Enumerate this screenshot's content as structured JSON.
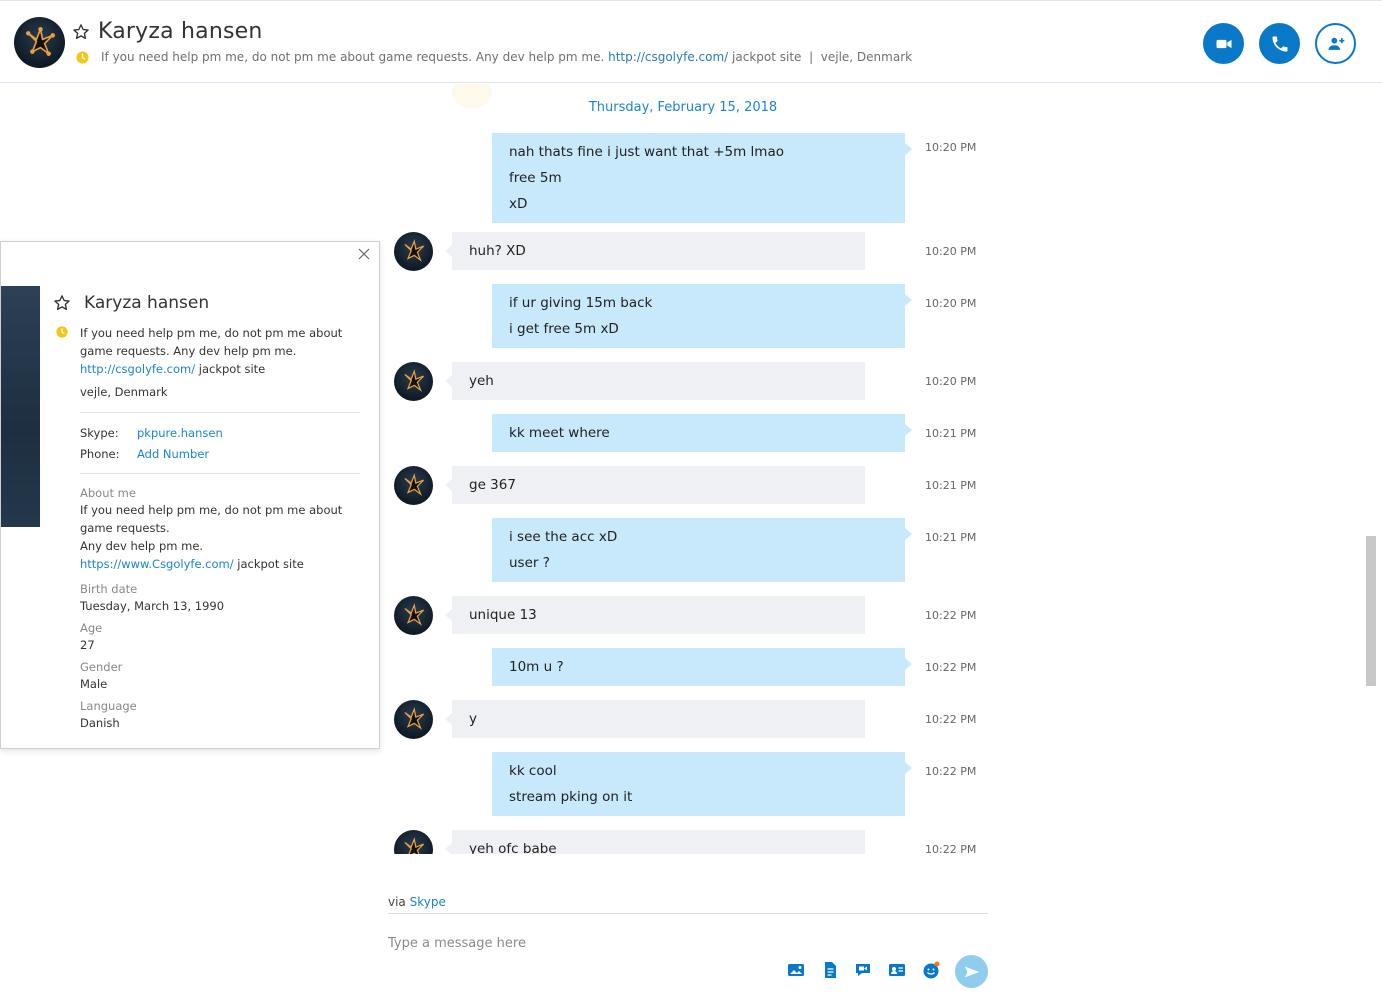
{
  "header": {
    "name": "Karyza hansen",
    "mood_text": "If you need help pm me, do not pm me about game requests. Any dev help pm me.",
    "mood_link": "http://csgolyfe.com/",
    "mood_after": "jackpot site",
    "separator": "|",
    "location": "vejle, Denmark"
  },
  "chat": {
    "date": "Thursday, February 15, 2018",
    "messages": [
      {
        "dir": "out",
        "lines": [
          "nah thats fine i just want that +5m lmao",
          "free 5m",
          "xD"
        ],
        "time": "10:20 PM"
      },
      {
        "dir": "in",
        "lines": [
          "huh? XD"
        ],
        "time": "10:20 PM"
      },
      {
        "dir": "out",
        "lines": [
          "if ur giving 15m back",
          "i get free 5m xD"
        ],
        "time": "10:20 PM"
      },
      {
        "dir": "in",
        "lines": [
          "yeh"
        ],
        "time": "10:20 PM"
      },
      {
        "dir": "out",
        "lines": [
          "kk meet where"
        ],
        "time": "10:21 PM"
      },
      {
        "dir": "in",
        "lines": [
          "ge 367"
        ],
        "time": "10:21 PM"
      },
      {
        "dir": "out",
        "lines": [
          "i see the acc xD",
          "user ?"
        ],
        "time": "10:21 PM"
      },
      {
        "dir": "in",
        "lines": [
          "unique 13"
        ],
        "time": "10:22 PM"
      },
      {
        "dir": "out",
        "lines": [
          "10m u ?"
        ],
        "time": "10:22 PM"
      },
      {
        "dir": "in",
        "lines": [
          "y"
        ],
        "time": "10:22 PM"
      },
      {
        "dir": "out",
        "lines": [
          "kk cool",
          "stream pking on it"
        ],
        "time": "10:22 PM"
      },
      {
        "dir": "in",
        "lines": [
          "yeh ofc babe"
        ],
        "time": "10:22 PM"
      }
    ]
  },
  "composer": {
    "via_prefix": "via",
    "via_link": "Skype",
    "placeholder": "Type a message here"
  },
  "profile": {
    "name": "Karyza hansen",
    "mood_text": "If you need help pm me, do not pm me about game requests. Any dev help pm me.",
    "mood_link": "http://csgolyfe.com/",
    "mood_after": "jackpot site",
    "location": "vejle, Denmark",
    "skype_label": "Skype:",
    "skype_value": "pkpure.hansen",
    "phone_label": "Phone:",
    "phone_value": "Add Number",
    "about_label": "About me",
    "about_line1": "If you need help pm me, do not pm me about game requests.",
    "about_line2": "Any dev help pm me.",
    "about_link": "https://www.Csgolyfe.com/",
    "about_after": "jackpot site",
    "birth_label": "Birth date",
    "birth_value": "Tuesday, March 13, 1990",
    "age_label": "Age",
    "age_value": "27",
    "gender_label": "Gender",
    "gender_value": "Male",
    "language_label": "Language",
    "language_value": "Danish"
  }
}
